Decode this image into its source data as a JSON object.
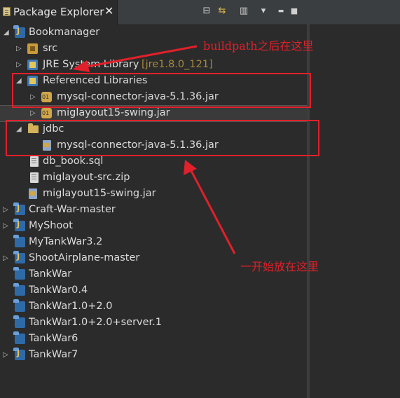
{
  "tab": {
    "title": "Package Explorer",
    "close": "✕"
  },
  "toolbar": {
    "collapse": "⊟",
    "link": "⇆",
    "filter": "▥",
    "menu": "▾",
    "minimize": "▬",
    "maximize": "■"
  },
  "tree": [
    {
      "label": "Bookmanager",
      "icon": "java-project-icon",
      "expanded": true
    },
    {
      "label": "src",
      "icon": "source-folder-icon",
      "expanded": false
    },
    {
      "label": "JRE System Library",
      "decoration": "[jre1.8.0_121]",
      "icon": "library-icon",
      "expanded": false
    },
    {
      "label": "Referenced Libraries",
      "icon": "library-icon",
      "expanded": true
    },
    {
      "label": "mysql-connector-java-5.1.36.jar",
      "icon": "jar-icon",
      "expanded": false
    },
    {
      "label": "miglayout15-swing.jar",
      "icon": "jar-icon",
      "expanded": false
    },
    {
      "label": "jdbc",
      "icon": "folder-icon",
      "expanded": true
    },
    {
      "label": "mysql-connector-java-5.1.36.jar",
      "icon": "jar-file-icon"
    },
    {
      "label": "db_book.sql",
      "icon": "file-icon"
    },
    {
      "label": "miglayout-src.zip",
      "icon": "file-icon"
    },
    {
      "label": "miglayout15-swing.jar",
      "icon": "jar-file-icon"
    },
    {
      "label": "Craft-War-master",
      "icon": "java-project-icon",
      "expanded": false
    },
    {
      "label": "MyShoot",
      "icon": "java-project-icon",
      "expanded": false
    },
    {
      "label": "MyTankWar3.2",
      "icon": "project-icon"
    },
    {
      "label": "ShootAirplane-master",
      "icon": "java-project-icon",
      "expanded": false
    },
    {
      "label": "TankWar",
      "icon": "project-icon"
    },
    {
      "label": "TankWar0.4",
      "icon": "project-icon"
    },
    {
      "label": "TankWar1.0+2.0",
      "icon": "project-icon"
    },
    {
      "label": "TankWar1.0+2.0+server.1",
      "icon": "project-icon"
    },
    {
      "label": "TankWar6",
      "icon": "project-icon"
    },
    {
      "label": "TankWar7",
      "icon": "java-project-icon",
      "expanded": false
    }
  ],
  "annotations": {
    "after_buildpath": "buildpath之后在这里",
    "initially_placed": "一开始放在这里"
  },
  "colors": {
    "annotation": "#e0202a",
    "background": "#2b2b2b",
    "text": "#dcdcdc"
  }
}
